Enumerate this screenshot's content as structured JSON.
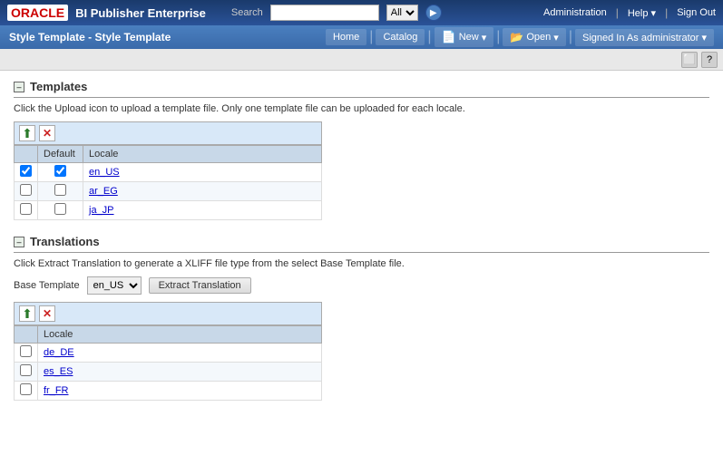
{
  "app": {
    "oracle_label": "ORACLE",
    "app_title": "BI Publisher Enterprise",
    "search_label": "Search",
    "search_value": "",
    "search_placeholder": "",
    "search_option": "All",
    "admin_link": "Administration",
    "help_link": "Help",
    "signout_link": "Sign Out"
  },
  "secondary_nav": {
    "page_title": "Style Template - Style Template",
    "home_label": "Home",
    "catalog_label": "Catalog",
    "new_label": "New",
    "open_label": "Open",
    "signed_in_label": "Signed In As",
    "username": "administrator"
  },
  "templates_section": {
    "toggle": "–",
    "title": "Templates",
    "description": "Click the Upload icon to upload a template file. Only one template file can be uploaded for each locale.",
    "col_default": "Default",
    "col_locale": "Locale",
    "rows": [
      {
        "id": 1,
        "checked": true,
        "locale": "en_US"
      },
      {
        "id": 2,
        "checked": false,
        "locale": "ar_EG"
      },
      {
        "id": 3,
        "checked": false,
        "locale": "ja_JP"
      }
    ]
  },
  "translations_section": {
    "toggle": "–",
    "title": "Translations",
    "description": "Click Extract Translation to generate a XLIFF file type from the select Base Template file.",
    "base_template_label": "Base Template",
    "base_template_value": "en_US",
    "extract_btn_label": "Extract Translation",
    "col_locale": "Locale",
    "rows": [
      {
        "id": 1,
        "locale": "de_DE"
      },
      {
        "id": 2,
        "locale": "es_ES"
      },
      {
        "id": 3,
        "locale": "fr_FR"
      }
    ]
  },
  "icons": {
    "upload": "⬆",
    "delete": "✕",
    "search": "🔍",
    "chevron_down": "▾",
    "folder": "📂",
    "new_page": "📄",
    "help": "?",
    "maximize": "⬜",
    "question": "?"
  }
}
